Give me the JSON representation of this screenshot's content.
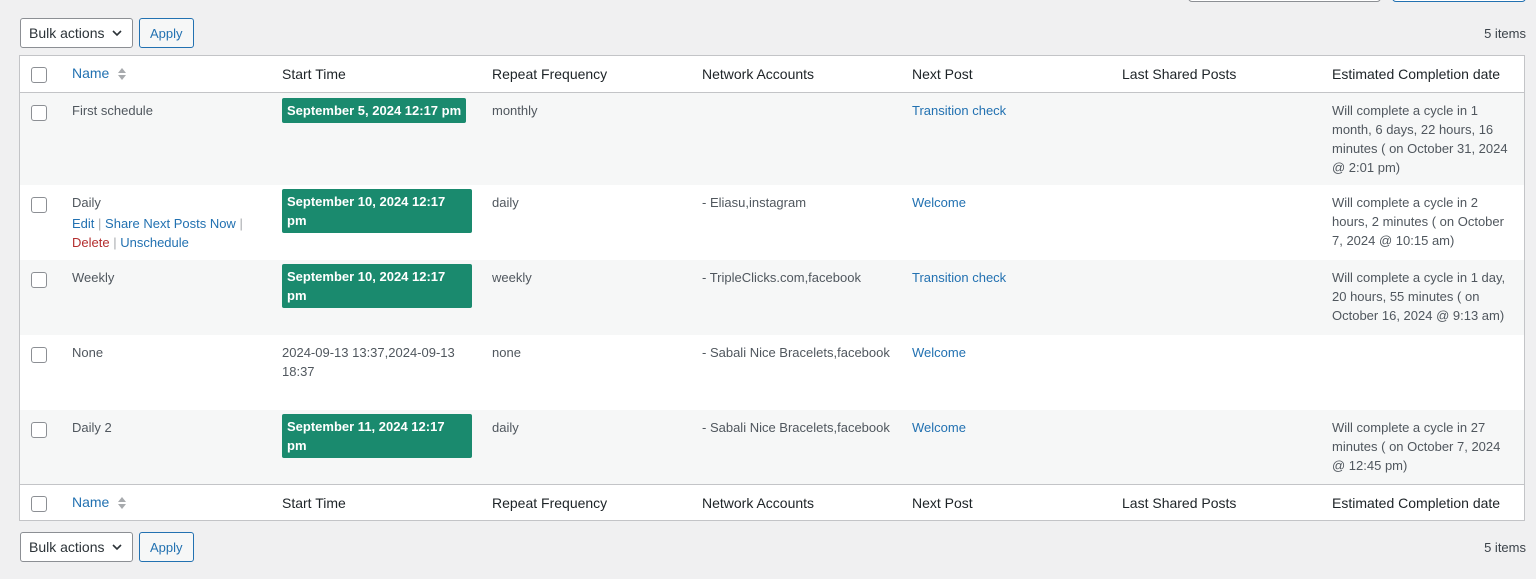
{
  "bulk": {
    "select_label": "Bulk actions",
    "apply_label": "Apply",
    "items_count": "5 items"
  },
  "columns": {
    "name": "Name",
    "start_time": "Start Time",
    "repeat": "Repeat Frequency",
    "accounts": "Network Accounts",
    "next_post": "Next Post",
    "last_shared": "Last Shared Posts",
    "completion": "Estimated Completion date"
  },
  "row_actions": {
    "edit": "Edit",
    "share": "Share Next Posts Now",
    "delete": "Delete",
    "unschedule": "Unschedule",
    "sep": "|"
  },
  "rows": [
    {
      "name": "First schedule",
      "start": "September 5, 2024 12:17 pm",
      "repeat": "monthly",
      "accounts": "",
      "next_post": "Transition check",
      "last_shared": "",
      "completion": "Will complete a cycle in 1 month, 6 days, 22 hours, 16 minutes ( on October 31, 2024 @ 2:01 pm)"
    },
    {
      "name": "Daily",
      "start": "September 10, 2024 12:17 pm",
      "repeat": "daily",
      "accounts": "- Eliasu,instagram",
      "next_post": "Welcome",
      "last_shared": "",
      "completion": "Will complete a cycle in 2 hours, 2 minutes ( on October 7, 2024 @ 10:15 am)"
    },
    {
      "name": "Weekly",
      "start": "September 10, 2024 12:17 pm",
      "repeat": "weekly",
      "accounts": "- TripleClicks.com,facebook",
      "next_post": "Transition check",
      "last_shared": "",
      "completion": "Will complete a cycle in 1 day, 20 hours, 55 minutes ( on October 16, 2024 @ 9:13 am)"
    },
    {
      "name": "None",
      "start": "2024-09-13 13:37,2024-09-13 18:37",
      "repeat": "none",
      "accounts": "- Sabali Nice Bracelets,facebook",
      "next_post": "Welcome",
      "last_shared": "",
      "completion": ""
    },
    {
      "name": "Daily 2",
      "start": "September 11, 2024 12:17 pm",
      "repeat": "daily",
      "accounts": "- Sabali Nice Bracelets,facebook",
      "next_post": "Welcome",
      "last_shared": "",
      "completion": "Will complete a cycle in 27 minutes ( on October 7, 2024 @ 12:45 pm)"
    }
  ],
  "colors": {
    "badge": "#1a8a6e",
    "link": "#2271b1",
    "delete": "#b32d2e"
  }
}
